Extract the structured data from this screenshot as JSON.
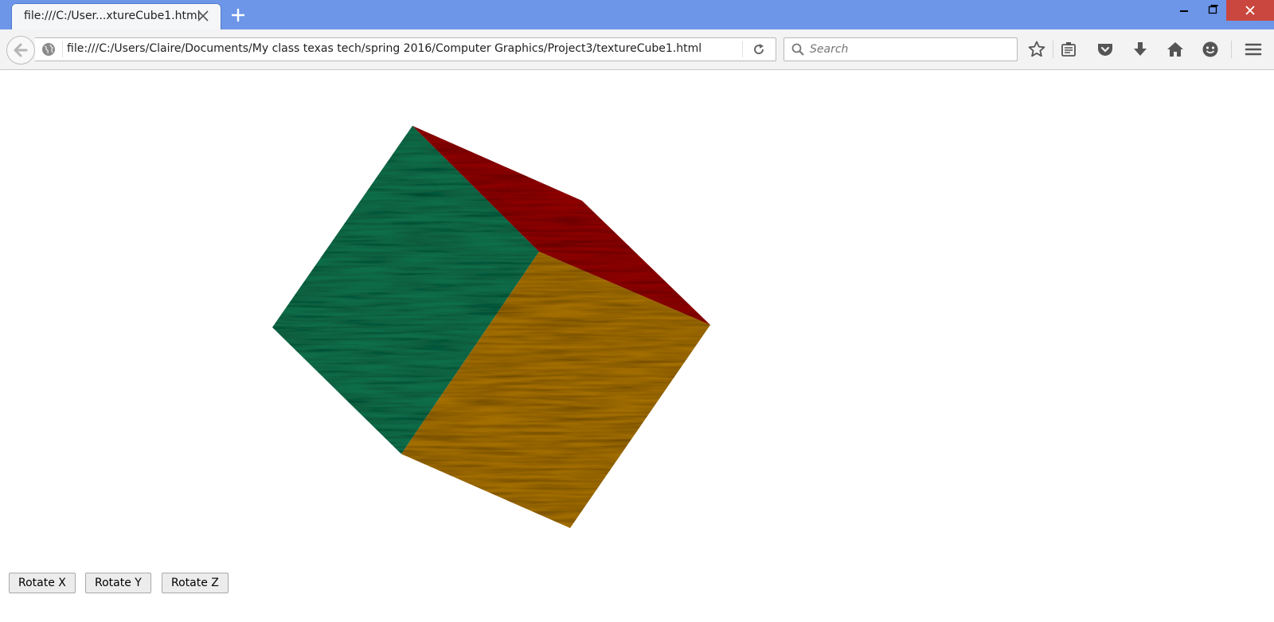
{
  "browser": {
    "tab_title": "file:///C:/User...xtureCube1.html",
    "url": "file:///C:/Users/Claire/Documents/My class texas tech/spring 2016/Computer Graphics/Project3/textureCube1.html",
    "search_placeholder": "Search"
  },
  "colors": {
    "titlebar": "#6d96e9",
    "close_button": "#c9473e",
    "cube_face_left": "#0a6e4a",
    "cube_face_top": "#8f0000",
    "cube_face_front": "#a36e06"
  },
  "buttons": {
    "rotate_x": "Rotate X",
    "rotate_y": "Rotate Y",
    "rotate_z": "Rotate Z"
  }
}
